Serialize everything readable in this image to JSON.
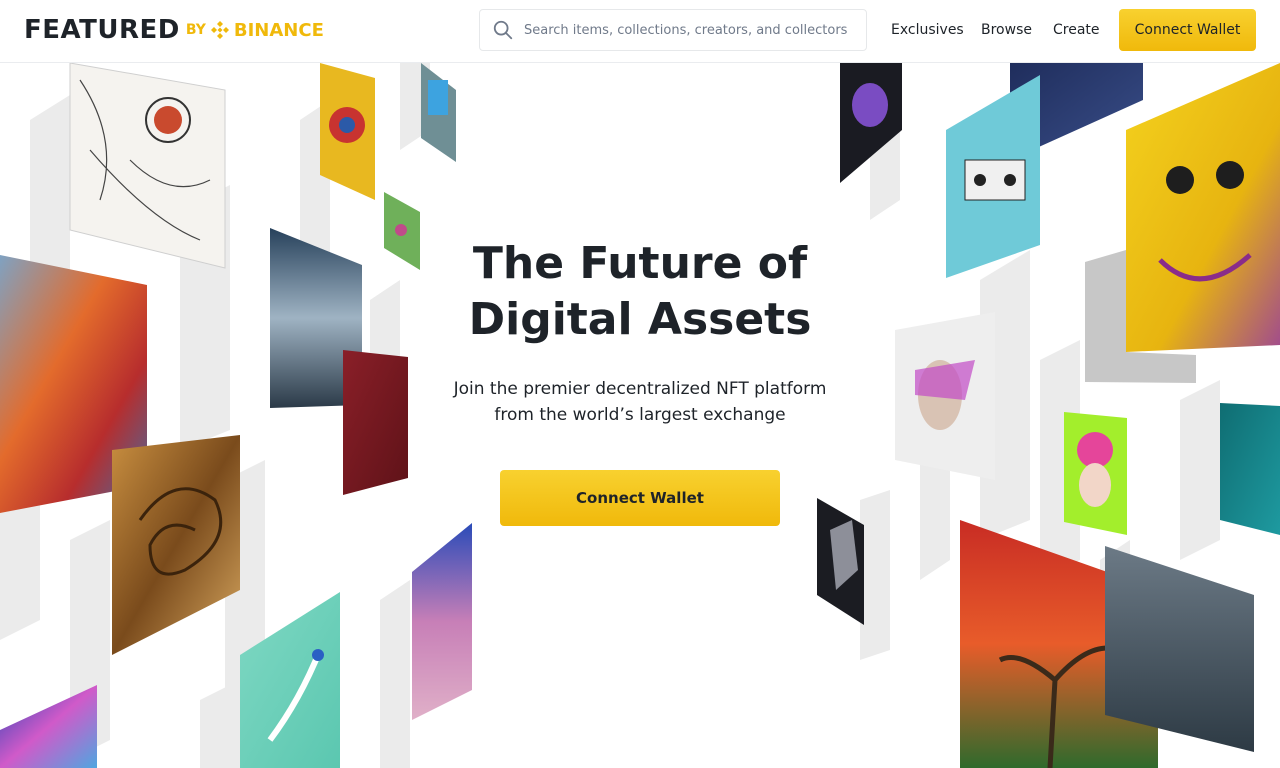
{
  "header": {
    "logo_main": "FEATURED",
    "logo_by": "BY",
    "logo_brand": "BINANCE",
    "search_placeholder": "Search items, collections, creators, and collectors",
    "nav": {
      "exclusives": "Exclusives",
      "browse": "Browse",
      "create": "Create"
    },
    "connect_wallet": "Connect Wallet"
  },
  "hero": {
    "title_line1": "The Future of",
    "title_line2": "Digital Assets",
    "subtitle_line1": "Join the premier decentralized NFT platform",
    "subtitle_line2": "from the world’s largest exchange",
    "cta": "Connect Wallet"
  },
  "colors": {
    "brand_yellow": "#F0B90B",
    "text_primary": "#1E2329",
    "text_secondary": "#707A8A"
  },
  "icons": {
    "search": "search-icon",
    "brand": "binance-logo-icon"
  }
}
